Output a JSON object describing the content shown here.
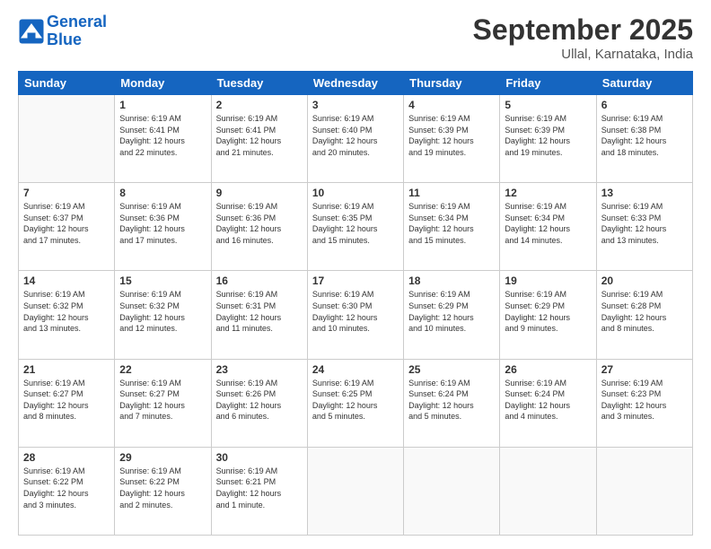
{
  "logo": {
    "line1": "General",
    "line2": "Blue"
  },
  "title": "September 2025",
  "location": "Ullal, Karnataka, India",
  "weekdays": [
    "Sunday",
    "Monday",
    "Tuesday",
    "Wednesday",
    "Thursday",
    "Friday",
    "Saturday"
  ],
  "weeks": [
    [
      {
        "day": "",
        "info": ""
      },
      {
        "day": "1",
        "info": "Sunrise: 6:19 AM\nSunset: 6:41 PM\nDaylight: 12 hours\nand 22 minutes."
      },
      {
        "day": "2",
        "info": "Sunrise: 6:19 AM\nSunset: 6:41 PM\nDaylight: 12 hours\nand 21 minutes."
      },
      {
        "day": "3",
        "info": "Sunrise: 6:19 AM\nSunset: 6:40 PM\nDaylight: 12 hours\nand 20 minutes."
      },
      {
        "day": "4",
        "info": "Sunrise: 6:19 AM\nSunset: 6:39 PM\nDaylight: 12 hours\nand 19 minutes."
      },
      {
        "day": "5",
        "info": "Sunrise: 6:19 AM\nSunset: 6:39 PM\nDaylight: 12 hours\nand 19 minutes."
      },
      {
        "day": "6",
        "info": "Sunrise: 6:19 AM\nSunset: 6:38 PM\nDaylight: 12 hours\nand 18 minutes."
      }
    ],
    [
      {
        "day": "7",
        "info": "Sunrise: 6:19 AM\nSunset: 6:37 PM\nDaylight: 12 hours\nand 17 minutes."
      },
      {
        "day": "8",
        "info": "Sunrise: 6:19 AM\nSunset: 6:36 PM\nDaylight: 12 hours\nand 17 minutes."
      },
      {
        "day": "9",
        "info": "Sunrise: 6:19 AM\nSunset: 6:36 PM\nDaylight: 12 hours\nand 16 minutes."
      },
      {
        "day": "10",
        "info": "Sunrise: 6:19 AM\nSunset: 6:35 PM\nDaylight: 12 hours\nand 15 minutes."
      },
      {
        "day": "11",
        "info": "Sunrise: 6:19 AM\nSunset: 6:34 PM\nDaylight: 12 hours\nand 15 minutes."
      },
      {
        "day": "12",
        "info": "Sunrise: 6:19 AM\nSunset: 6:34 PM\nDaylight: 12 hours\nand 14 minutes."
      },
      {
        "day": "13",
        "info": "Sunrise: 6:19 AM\nSunset: 6:33 PM\nDaylight: 12 hours\nand 13 minutes."
      }
    ],
    [
      {
        "day": "14",
        "info": "Sunrise: 6:19 AM\nSunset: 6:32 PM\nDaylight: 12 hours\nand 13 minutes."
      },
      {
        "day": "15",
        "info": "Sunrise: 6:19 AM\nSunset: 6:32 PM\nDaylight: 12 hours\nand 12 minutes."
      },
      {
        "day": "16",
        "info": "Sunrise: 6:19 AM\nSunset: 6:31 PM\nDaylight: 12 hours\nand 11 minutes."
      },
      {
        "day": "17",
        "info": "Sunrise: 6:19 AM\nSunset: 6:30 PM\nDaylight: 12 hours\nand 10 minutes."
      },
      {
        "day": "18",
        "info": "Sunrise: 6:19 AM\nSunset: 6:29 PM\nDaylight: 12 hours\nand 10 minutes."
      },
      {
        "day": "19",
        "info": "Sunrise: 6:19 AM\nSunset: 6:29 PM\nDaylight: 12 hours\nand 9 minutes."
      },
      {
        "day": "20",
        "info": "Sunrise: 6:19 AM\nSunset: 6:28 PM\nDaylight: 12 hours\nand 8 minutes."
      }
    ],
    [
      {
        "day": "21",
        "info": "Sunrise: 6:19 AM\nSunset: 6:27 PM\nDaylight: 12 hours\nand 8 minutes."
      },
      {
        "day": "22",
        "info": "Sunrise: 6:19 AM\nSunset: 6:27 PM\nDaylight: 12 hours\nand 7 minutes."
      },
      {
        "day": "23",
        "info": "Sunrise: 6:19 AM\nSunset: 6:26 PM\nDaylight: 12 hours\nand 6 minutes."
      },
      {
        "day": "24",
        "info": "Sunrise: 6:19 AM\nSunset: 6:25 PM\nDaylight: 12 hours\nand 5 minutes."
      },
      {
        "day": "25",
        "info": "Sunrise: 6:19 AM\nSunset: 6:24 PM\nDaylight: 12 hours\nand 5 minutes."
      },
      {
        "day": "26",
        "info": "Sunrise: 6:19 AM\nSunset: 6:24 PM\nDaylight: 12 hours\nand 4 minutes."
      },
      {
        "day": "27",
        "info": "Sunrise: 6:19 AM\nSunset: 6:23 PM\nDaylight: 12 hours\nand 3 minutes."
      }
    ],
    [
      {
        "day": "28",
        "info": "Sunrise: 6:19 AM\nSunset: 6:22 PM\nDaylight: 12 hours\nand 3 minutes."
      },
      {
        "day": "29",
        "info": "Sunrise: 6:19 AM\nSunset: 6:22 PM\nDaylight: 12 hours\nand 2 minutes."
      },
      {
        "day": "30",
        "info": "Sunrise: 6:19 AM\nSunset: 6:21 PM\nDaylight: 12 hours\nand 1 minute."
      },
      {
        "day": "",
        "info": ""
      },
      {
        "day": "",
        "info": ""
      },
      {
        "day": "",
        "info": ""
      },
      {
        "day": "",
        "info": ""
      }
    ]
  ]
}
